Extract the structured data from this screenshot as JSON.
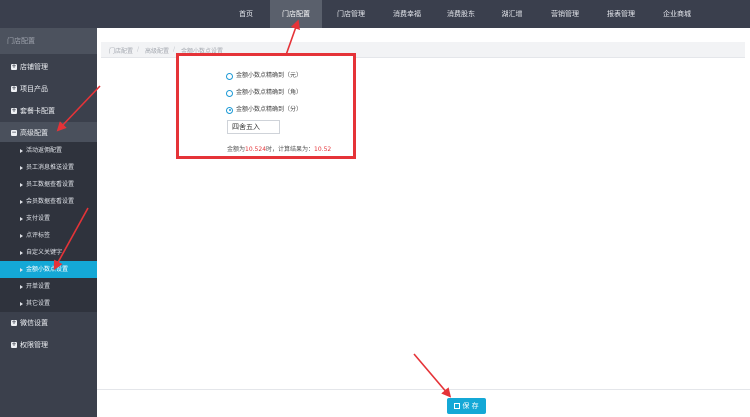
{
  "nav": {
    "items": [
      "首页",
      "门店配置",
      "门店管理",
      "消费幸福",
      "消费股东",
      "湖汇增",
      "营销管理",
      "报表管理",
      "企业商城"
    ],
    "active_index": 1
  },
  "sidebar": {
    "header": "门店配置",
    "groups": [
      {
        "label": "店铺管理"
      },
      {
        "label": "项目产品"
      },
      {
        "label": "套餐卡配置"
      },
      {
        "label": "高级配置",
        "active": true
      }
    ],
    "subitems": [
      "活动返佣配置",
      "员工消息推送设置",
      "员工数据查看设置",
      "会员数据查看设置",
      "支付设置",
      "点评标签",
      "自定义关键字",
      "金额小数点设置",
      "开单设置",
      "其它设置"
    ],
    "active_sub_index": 7,
    "groups_after": [
      {
        "label": "微信设置"
      },
      {
        "label": "权限管理"
      }
    ]
  },
  "breadcrumb": [
    "门店配置",
    "高级配置",
    "金额小数点设置"
  ],
  "rounding": {
    "options": [
      "金额小数点精确到（元）",
      "金额小数点精确到（角）",
      "金额小数点精确到（分）"
    ],
    "selected_index": 2,
    "method": "四舍五入",
    "result_prefix": "金额为",
    "result_amount": "10.524",
    "result_middle": "时，计算结果为：",
    "result_value": "10.52"
  },
  "footer": {
    "save_label": "保 存"
  },
  "colors": {
    "accent": "#14a8d6",
    "highlight": "#e53338",
    "nav_bg": "#3a3f4d"
  }
}
